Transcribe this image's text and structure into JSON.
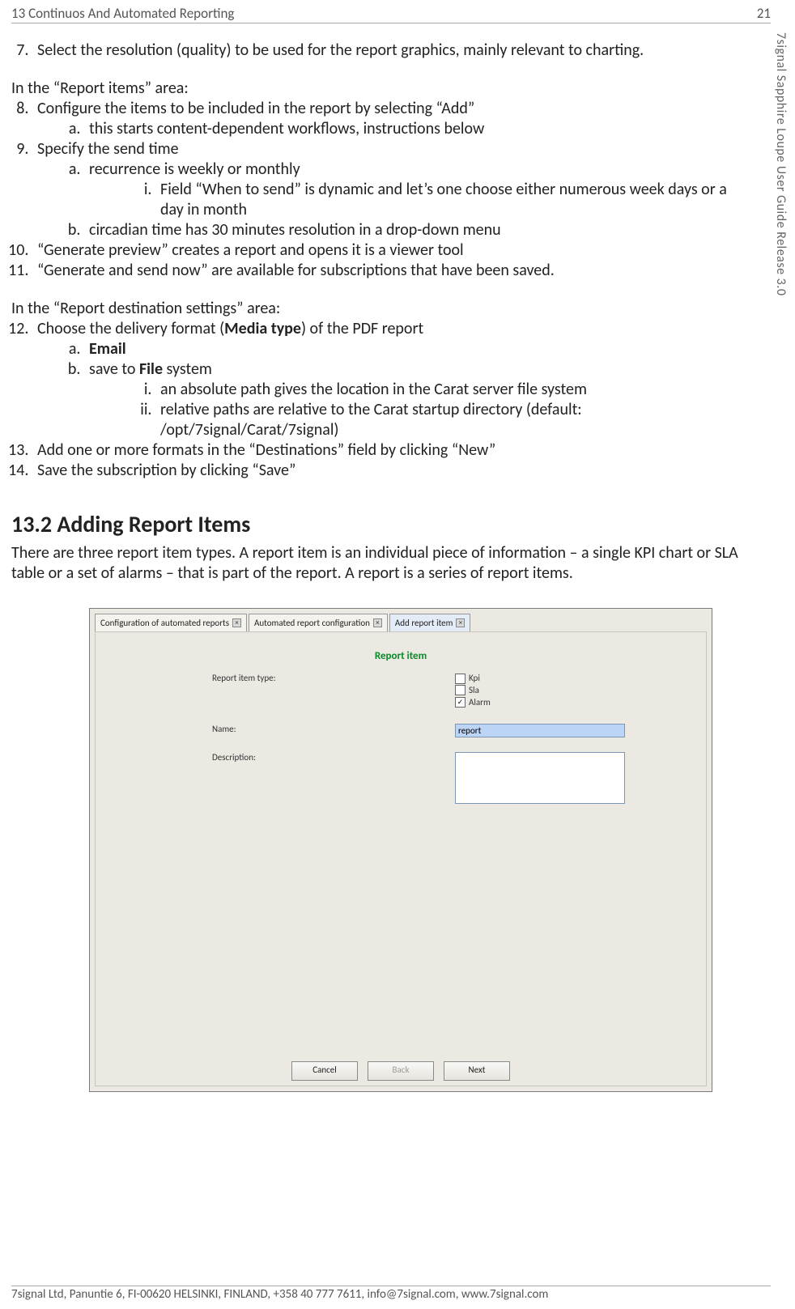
{
  "header": {
    "left": "13 Continuos And Automated Reporting",
    "right": "21"
  },
  "sidebar": "7signal Sapphire Loupe User Guide Release 3.0",
  "list7": "Select the resolution (quality) to be used for the report graphics, mainly relevant to charting.",
  "preItems": "In the “Report items” area:",
  "list8": "Configure the items to be included in the report by selecting “Add”",
  "list8a": "this starts content-dependent workflows, instructions below",
  "list9": "Specify the send time",
  "list9a": "recurrence is weekly or monthly",
  "list9ai": "Field “When to send” is dynamic and let’s one choose either numerous week days or a day in month",
  "list9b": "circadian time has 30 minutes resolution in a drop-down menu",
  "list10": "“Generate preview” creates a report and opens it is a viewer tool",
  "list11": "“Generate and send now” are available for subscriptions that have been saved.",
  "preDest": "In the “Report destination settings” area:",
  "list12_before": "Choose the delivery format (",
  "list12_bold": "Media type",
  "list12_after": ") of the PDF report",
  "list12a": "Email",
  "list12b_before": "save to ",
  "list12b_bold": "File",
  "list12b_after": " system",
  "list12bi": "an absolute path gives the location in the Carat server file system",
  "list12bii": "relative paths are relative to the Carat startup directory (default: /opt/7signal/Carat/7signal)",
  "list13": "Add one or more formats in the “Destinations” field by clicking “New”",
  "list14": "Save the subscription by clicking “Save”",
  "sectionTitle": "13.2 Adding Report Items",
  "sectionBody": "There are three report item types. A report item is an individual piece of information – a single KPI chart or SLA table or a set of alarms – that is part of the report. A report is a series of report items.",
  "shot": {
    "tabs": {
      "t1": "Configuration of automated reports",
      "t2": "Automated report configuration",
      "t3": "Add report item"
    },
    "heading": "Report item",
    "labels": {
      "type": "Report item type:",
      "name": "Name:",
      "desc": "Description:"
    },
    "checks": {
      "kpi": "Kpi",
      "sla": "Sla",
      "alarm": "Alarm"
    },
    "nameValue": "report",
    "buttons": {
      "cancel": "Cancel",
      "back": "Back",
      "next": "Next"
    }
  },
  "footer": "7signal Ltd, Panuntie 6, FI-00620 HELSINKI, FINLAND, +358 40 777 7611, info@7signal.com, www.7signal.com"
}
